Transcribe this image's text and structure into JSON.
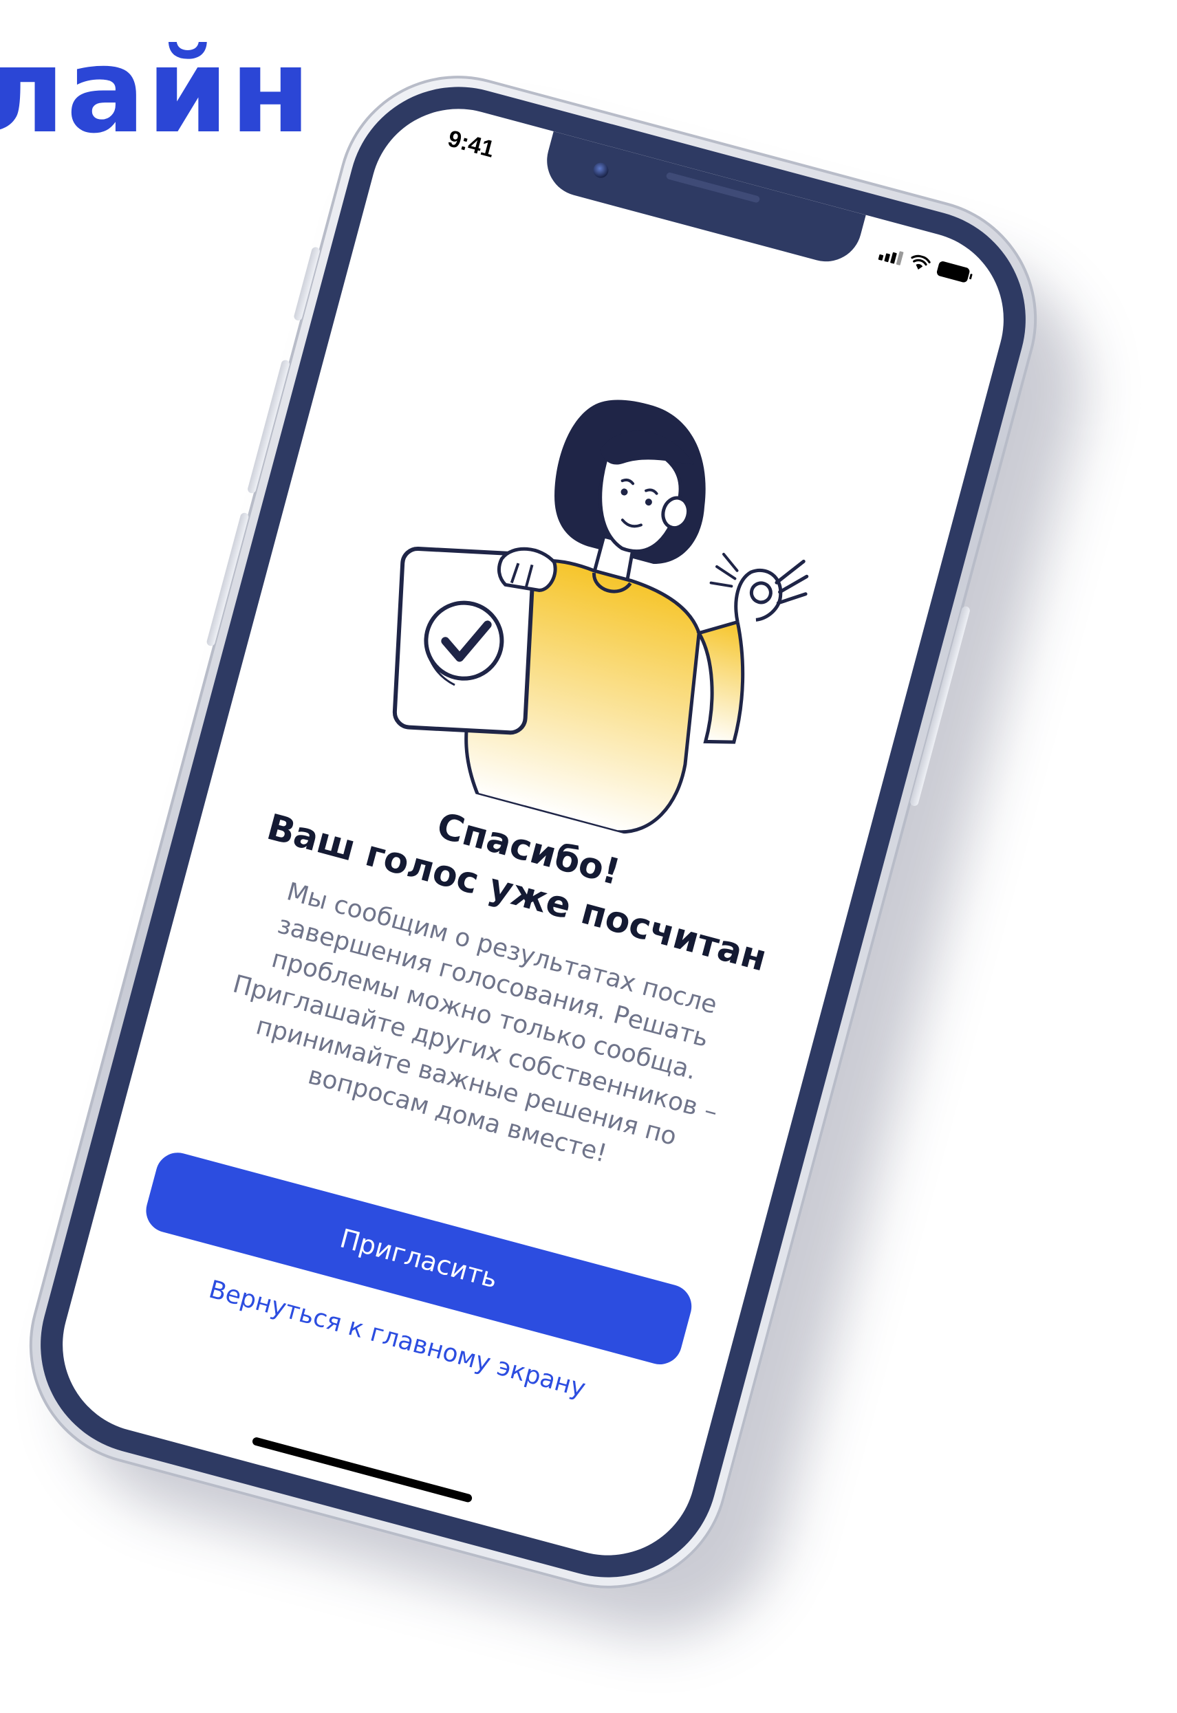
{
  "brand": {
    "word": "лайн",
    "color": "#2b46d6"
  },
  "status_bar": {
    "time": "9:41",
    "icons": [
      "cellular-signal-icon",
      "wifi-icon",
      "battery-icon"
    ]
  },
  "illustration": {
    "description_icon": "woman-holding-checked-ballot-illustration"
  },
  "confirmation": {
    "title_line1": "Спасибо!",
    "title_line2": "Ваш голос уже посчитан",
    "paragraph1": "Мы сообщим о результатах после завершения голосования. Решать проблемы можно только сообща.",
    "paragraph2": "Приглашайте других собственников – принимайте важные решения по вопросам дома вместе!"
  },
  "actions": {
    "invite_label": "Пригласить",
    "home_label": "Вернуться к главному экрану"
  },
  "colors": {
    "primary": "#2c4de0",
    "device_bezel": "#2e3a63",
    "title_text": "#141a33",
    "body_text": "#6f748a",
    "illustration_accent": "#f6c52b"
  }
}
